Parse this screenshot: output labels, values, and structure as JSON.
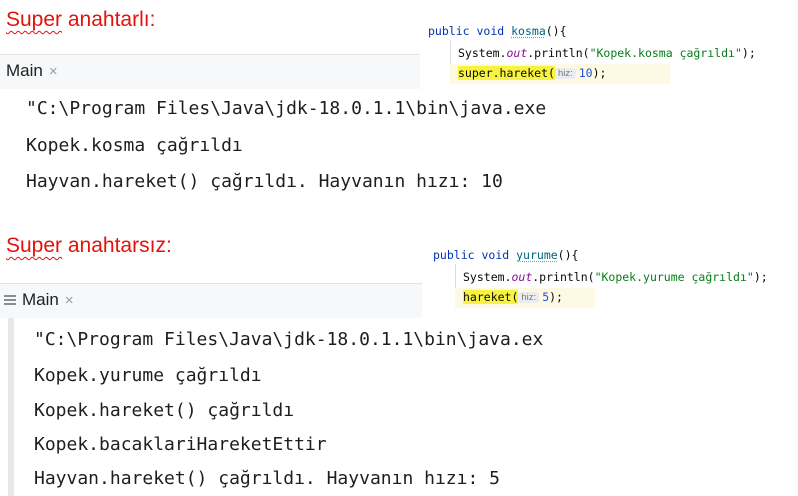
{
  "section_with_super": {
    "heading_word": "Super",
    "heading_rest": " anahtarlı:",
    "tab_label": "Main",
    "tab_close": "×",
    "console_lines": [
      "\"C:\\Program Files\\Java\\jdk-18.0.1.1\\bin\\java.exe",
      "Kopek.kosma çağrıldı",
      "Hayvan.hareket() çağrıldı. Hayvanın hızı: 10"
    ],
    "code": {
      "line1_kw1": "public",
      "line1_kw2": "void",
      "line1_name": "kosma",
      "line1_rest": "(){",
      "line2_prefix": "System.",
      "line2_out": "out",
      "line2_call": ".println(",
      "line2_str": "\"Kopek.kosma çağrıldı\"",
      "line2_end": ");",
      "line3_call": "super.hareket(",
      "line3_hint": "hiz:",
      "line3_arg": "10",
      "line3_end": ");"
    }
  },
  "section_without_super": {
    "heading_word": "Super",
    "heading_rest": " anahtarsız:",
    "tab_label": "Main",
    "tab_close": "×",
    "console_lines": [
      "\"C:\\Program Files\\Java\\jdk-18.0.1.1\\bin\\java.ex",
      "Kopek.yurume çağrıldı",
      "Kopek.hareket() çağrıldı",
      "Kopek.bacaklariHareketEttir",
      "Hayvan.hareket() çağrıldı. Hayvanın hızı: 5"
    ],
    "code": {
      "line1_kw1": "public",
      "line1_kw2": "void",
      "line1_name": "yurume",
      "line1_rest": "(){",
      "line2_prefix": "System.",
      "line2_out": "out",
      "line2_call": ".println(",
      "line2_str": "\"Kopek.yurume çağrıldı\"",
      "line2_end": ");",
      "line3_call": "hareket(",
      "line3_hint": "hiz:",
      "line3_arg": "5",
      "line3_end": ");"
    }
  },
  "colors": {
    "heading": "#e3120b",
    "highlight": "#f8f33e",
    "keyword": "#0033b3",
    "string": "#067d17"
  }
}
